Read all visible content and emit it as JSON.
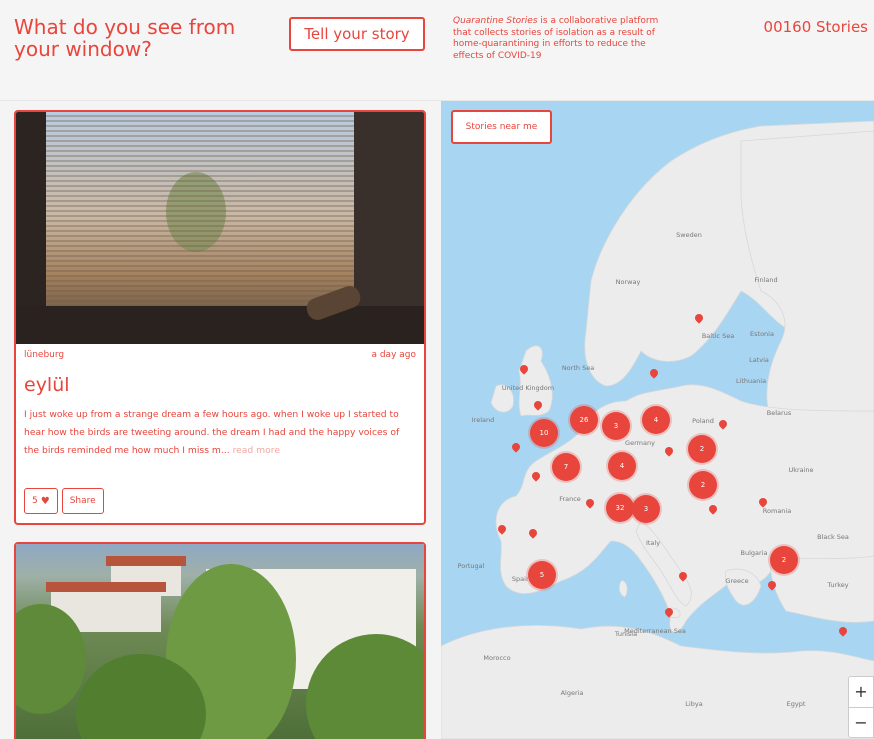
{
  "header": {
    "title": "What do you see from your window?",
    "tell_button": "Tell your story",
    "about_lead": "Quarantine Stories",
    "about_rest": " is a collaborative platform that collects stories of isolation as a result of home-quarantining in efforts to reduce the effects of COVID-19",
    "story_count": "00160 Stories"
  },
  "stories": [
    {
      "location": "lüneburg",
      "time": "a day ago",
      "title": "eylül",
      "excerpt": "I just woke up from a strange dream a few hours ago. when I woke up I started to hear how the birds are tweeting around. the dream I had and the happy voices of the birds reminded me how much I miss m...",
      "read_more": "read more",
      "likes": "5",
      "share_label": "Share"
    }
  ],
  "map": {
    "near_button": "Stories near me",
    "zoom_in": "+",
    "zoom_out": "−",
    "clusters": [
      "10",
      "26",
      "3",
      "4",
      "7",
      "4",
      "2",
      "2",
      "32",
      "3",
      "5",
      "2"
    ],
    "labels": {
      "sweden": "Sweden",
      "norway": "Norway",
      "finland": "Finland",
      "estonia": "Estonia",
      "latvia": "Latvia",
      "lithuania": "Lithuania",
      "uk": "United Kingdom",
      "ireland": "Ireland",
      "northsea": "North Sea",
      "belarus": "Belarus",
      "poland": "Poland",
      "germany": "Germany",
      "ukraine": "Ukraine",
      "france": "France",
      "italy": "Italy",
      "spain": "Spain",
      "portugal": "Portugal",
      "romania": "Romania",
      "bulgaria": "Bulgaria",
      "greece": "Greece",
      "turkey": "Turkey",
      "blacksea": "Black Sea",
      "mediterranean": "Mediterranean Sea",
      "morocco": "Morocco",
      "algeria": "Algeria",
      "libya": "Libya",
      "egypt": "Egypt",
      "tunisia": "Tunisia",
      "balticsea": "Baltic Sea"
    }
  },
  "colors": {
    "accent": "#e8453c",
    "sea": "#a8d6f2",
    "land": "#ececec"
  }
}
